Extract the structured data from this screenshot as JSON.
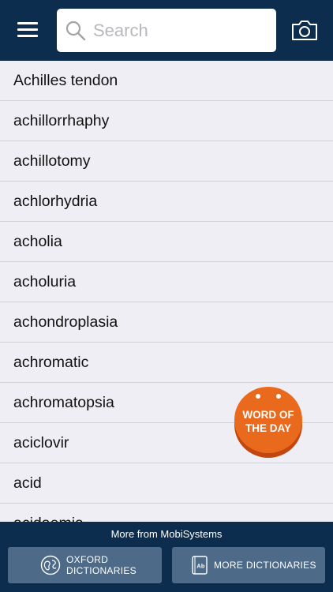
{
  "header": {
    "menu_icon": "hamburger-menu-icon",
    "search": {
      "placeholder": "Search",
      "value": "",
      "icon": "search-icon"
    },
    "camera_icon": "camera-icon"
  },
  "words": [
    "Achilles tendon",
    "achillorrhaphy",
    "achillotomy",
    "achlorhydria",
    "acholia",
    "acholuria",
    "achondroplasia",
    "achromatic",
    "achromatopsia",
    "aciclovir",
    "acid",
    "acidaemia"
  ],
  "word_of_the_day": {
    "line1": "WORD OF",
    "line2": "THE DAY"
  },
  "footer": {
    "more_from": "More from MobiSystems",
    "oxford_button": {
      "line1": "OXFORD",
      "line2": "DICTIONARIES",
      "icon": "oxford-globe-icon"
    },
    "more_button": {
      "label": "MORE DICTIONARIES",
      "icon": "dictionary-book-icon"
    }
  },
  "colors": {
    "header_bg": "#0d2d4e",
    "list_bg": "#efeef4",
    "accent_orange": "#ea6a1d",
    "footer_button_bg": "#4d6a88"
  }
}
